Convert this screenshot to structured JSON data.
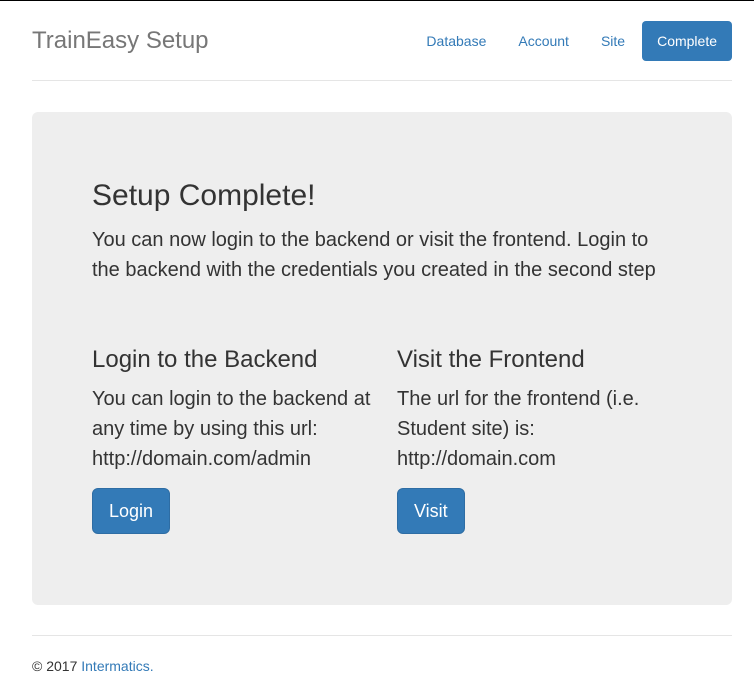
{
  "header": {
    "brand": "TrainEasy Setup",
    "nav": [
      {
        "label": "Database",
        "active": false
      },
      {
        "label": "Account",
        "active": false
      },
      {
        "label": "Site",
        "active": false
      },
      {
        "label": "Complete",
        "active": true
      }
    ]
  },
  "main": {
    "title": "Setup Complete!",
    "lead": "You can now login to the backend or visit the frontend. Login to the backend with the credentials you created in the second step",
    "backend": {
      "heading": "Login to the Backend",
      "text": "You can login to the backend at any time by using this url: http://domain.com/admin",
      "button": "Login"
    },
    "frontend": {
      "heading": "Visit the Frontend",
      "text": "The url for the frontend (i.e. Student site) is: http://domain.com",
      "button": "Visit"
    }
  },
  "footer": {
    "copyright": "© 2017",
    "company": "Intermatics."
  },
  "colors": {
    "primary": "#337ab7",
    "panel": "#eeeeee",
    "text": "#333333",
    "brand": "#777777"
  }
}
